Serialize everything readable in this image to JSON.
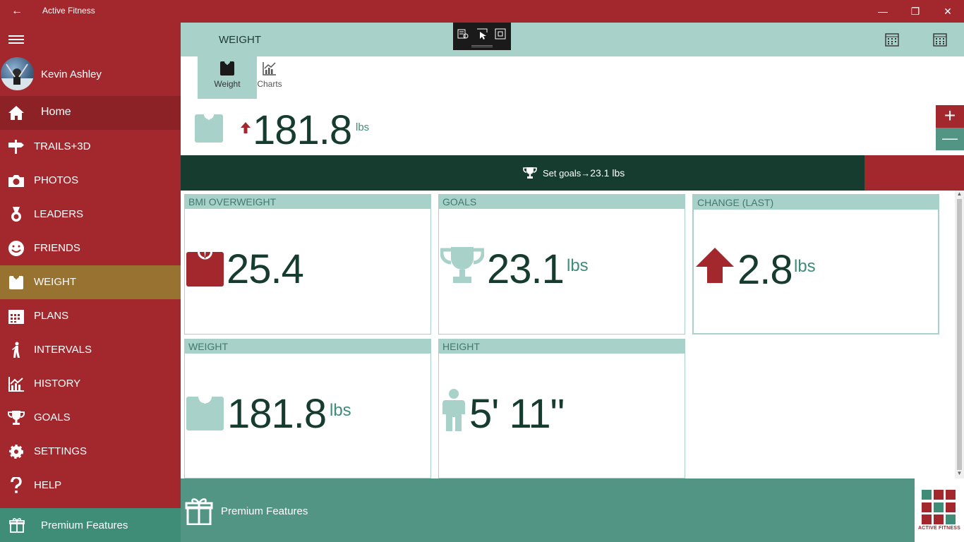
{
  "window": {
    "title": "Active Fitness",
    "back_glyph": "←",
    "minimize_glyph": "—",
    "restore_glyph": "❐",
    "close_glyph": "✕"
  },
  "sidebar": {
    "user_name": "Kevin Ashley",
    "items": [
      {
        "label": "Home",
        "icon": "home-icon"
      },
      {
        "label": "TRAILS+3D",
        "icon": "signpost-icon"
      },
      {
        "label": "PHOTOS",
        "icon": "camera-icon"
      },
      {
        "label": "LEADERS",
        "icon": "medal-icon"
      },
      {
        "label": "FRIENDS",
        "icon": "smiley-icon"
      },
      {
        "label": "WEIGHT",
        "icon": "scale-icon"
      },
      {
        "label": "PLANS",
        "icon": "calendar-icon"
      },
      {
        "label": "INTERVALS",
        "icon": "runner-icon"
      },
      {
        "label": "HISTORY",
        "icon": "chart-icon"
      },
      {
        "label": "GOALS",
        "icon": "trophy-icon"
      },
      {
        "label": "SETTINGS",
        "icon": "gear-icon"
      },
      {
        "label": "HELP",
        "icon": "question-icon"
      }
    ],
    "premium_label": "Premium Features"
  },
  "header": {
    "title": "WEIGHT"
  },
  "tabs": [
    {
      "label": "Weight",
      "active": true
    },
    {
      "label": "Charts",
      "active": false
    }
  ],
  "current": {
    "value": "181.8",
    "unit": "lbs",
    "plus": "+",
    "minus": "—"
  },
  "goal_bar": {
    "label": "Set goals",
    "arrow": "→",
    "value": "23.1 lbs"
  },
  "tiles": {
    "bmi": {
      "title": "BMI OVERWEIGHT",
      "value": "25.4"
    },
    "goals": {
      "title": "GOALS",
      "value": "23.1",
      "unit": "lbs"
    },
    "change": {
      "title": "CHANGE (LAST)",
      "value": "2.8",
      "unit": "lbs"
    },
    "weight": {
      "title": "WEIGHT",
      "value": "181.8",
      "unit": "lbs"
    },
    "height": {
      "title": "HEIGHT",
      "value": "5' 11\""
    }
  },
  "bottom": {
    "premium_label": "Premium Features",
    "logo_text": "ACTIVE FITNESS"
  },
  "colors": {
    "brand_red": "#a3282d",
    "teal_light": "#a8d1c9",
    "teal_dark": "#163b2f",
    "teal_mid": "#529584",
    "active_gold": "#987230"
  }
}
